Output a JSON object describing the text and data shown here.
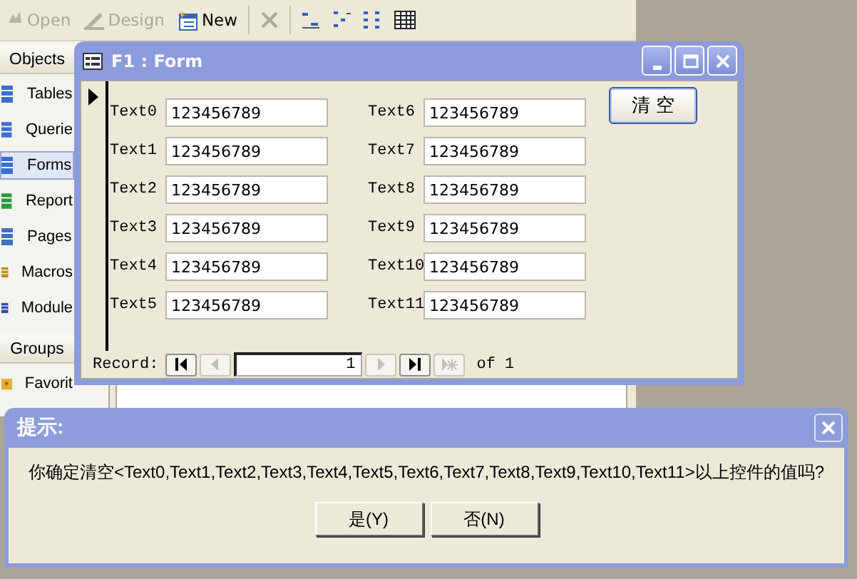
{
  "toolbar": [
    {
      "label": "Open",
      "disabled": true
    },
    {
      "label": "Design",
      "disabled": true
    },
    {
      "label": "New",
      "disabled": false
    }
  ],
  "sidebar": {
    "header": "Objects",
    "items": [
      {
        "label": "Tables",
        "selected": false
      },
      {
        "label": "Querie",
        "selected": false
      },
      {
        "label": "Forms",
        "selected": true
      },
      {
        "label": "Report",
        "selected": false
      },
      {
        "label": "Pages",
        "selected": false
      },
      {
        "label": "Macros",
        "selected": false
      },
      {
        "label": "Module",
        "selected": false
      }
    ],
    "groups_header": "Groups",
    "group_items": [
      {
        "label": "Favorit",
        "selected": false
      }
    ]
  },
  "form_window": {
    "title": "F1 : Form",
    "fields": [
      {
        "label": "Text0",
        "value": "123456789"
      },
      {
        "label": "Text1",
        "value": "123456789"
      },
      {
        "label": "Text2",
        "value": "123456789"
      },
      {
        "label": "Text3",
        "value": "123456789"
      },
      {
        "label": "Text4",
        "value": "123456789"
      },
      {
        "label": "Text5",
        "value": "123456789"
      },
      {
        "label": "Text6",
        "value": "123456789"
      },
      {
        "label": "Text7",
        "value": "123456789"
      },
      {
        "label": "Text8",
        "value": "123456789"
      },
      {
        "label": "Text9",
        "value": "123456789"
      },
      {
        "label": "Text10",
        "value": "123456789"
      },
      {
        "label": "Text11",
        "value": "123456789"
      }
    ],
    "clear_button": "清 空",
    "navigation": {
      "label": "Record:",
      "current": "1",
      "total": "of 1",
      "buttons": [
        {
          "kind": "first",
          "disabled": false
        },
        {
          "kind": "prev",
          "disabled": true
        },
        {
          "kind": "next",
          "disabled": true
        },
        {
          "kind": "last",
          "disabled": false
        },
        {
          "kind": "new",
          "disabled": true
        }
      ]
    }
  },
  "dialog": {
    "title": "提示:",
    "message": "你确定清空<Text0,Text1,Text2,Text3,Text4,Text5,Text6,Text7,Text8,Text9,Text10,Text11>以上控件的值吗?",
    "buttons": [
      "是(Y)",
      "否(N)"
    ]
  }
}
